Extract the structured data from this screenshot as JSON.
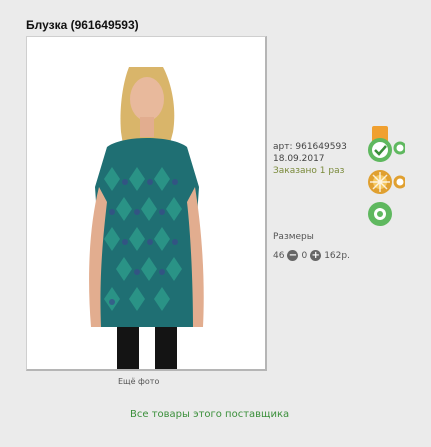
{
  "product": {
    "title": "Блузка (961649593)",
    "article": "арт: 961649593",
    "date": "18.09.2017",
    "ordered": "Заказано 1 раз"
  },
  "sizes": {
    "label": "Размеры",
    "size": "46",
    "count": "0",
    "price": "162р.",
    "minus_icon": "minus-circle-icon",
    "plus_icon": "plus-circle-icon"
  },
  "photo": {
    "more_label": "Ещё фото"
  },
  "icons": [
    "check-badge-icon",
    "flower-icon",
    "leaf-icon",
    "extra-badge-icon"
  ],
  "supplier": {
    "link_label": "Все товары этого поставщика"
  },
  "colors": {
    "background": "#ebebeb",
    "link_green": "#3a8f3a",
    "check_green": "#5fb85f",
    "orange_badge": "#f0a030"
  }
}
